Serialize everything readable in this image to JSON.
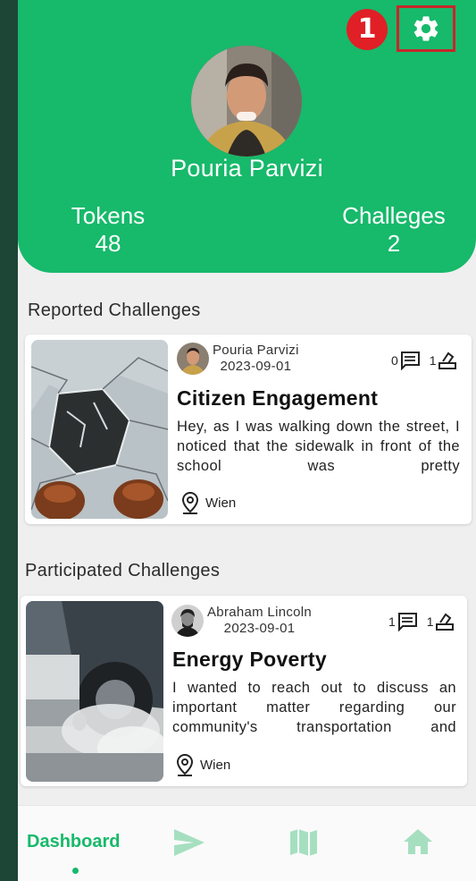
{
  "header": {
    "badge": "1",
    "user_name": "Pouria Parvizi",
    "tokens_label": "Tokens",
    "tokens_value": "48",
    "challenges_label": "Challeges",
    "challenges_value": "2"
  },
  "reported": {
    "section_title": "Reported Challenges",
    "card": {
      "author": "Pouria Parvizi",
      "date": "2023-09-01",
      "comments": "0",
      "votes": "1",
      "title": "Citizen Engagement",
      "description": "Hey, as I was walking down the street, I noticed that the sidewalk in front of the school was pretty",
      "location": "Wien"
    }
  },
  "participated": {
    "section_title": "Participated Challenges",
    "card": {
      "author": "Abraham Lincoln",
      "date": "2023-09-01",
      "comments": "1",
      "votes": "1",
      "title": "Energy Poverty",
      "description": "I wanted to reach out to discuss an important matter regarding our community's transportation and",
      "location": "Wien"
    }
  },
  "nav": {
    "dashboard_label": "Dashboard",
    "icons": [
      "send-icon",
      "map-icon",
      "home-icon"
    ]
  },
  "colors": {
    "primary": "#17b96b",
    "badge": "#e01f26",
    "highlight_border": "#c8262a",
    "icon_inactive": "#a6dfc0"
  }
}
